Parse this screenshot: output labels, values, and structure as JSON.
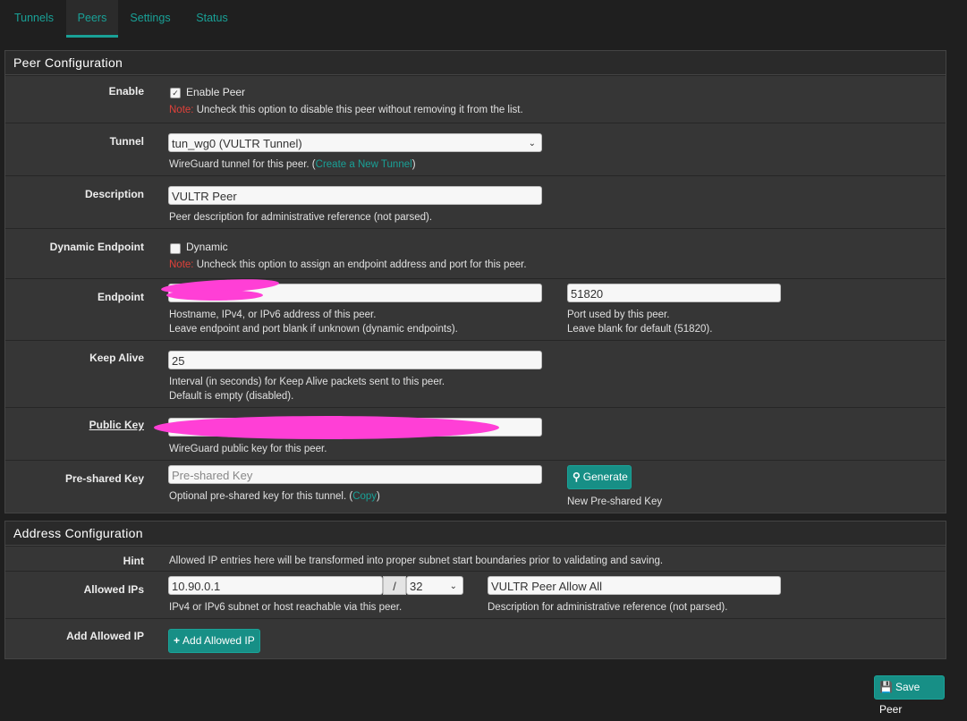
{
  "tabs": [
    {
      "label": "Tunnels"
    },
    {
      "label": "Peers",
      "active": true
    },
    {
      "label": "Settings"
    },
    {
      "label": "Status"
    }
  ],
  "peer_config": {
    "title": "Peer Configuration",
    "enable": {
      "label": "Enable",
      "checkbox_label": "Enable Peer",
      "checked": true,
      "note_prefix": "Note:",
      "note_text": " Uncheck this option to disable this peer without removing it from the list."
    },
    "tunnel": {
      "label": "Tunnel",
      "value": "tun_wg0 (VULTR Tunnel)",
      "help_pre": "WireGuard tunnel for this peer. (",
      "help_link": "Create a New Tunnel",
      "help_post": ")"
    },
    "description": {
      "label": "Description",
      "value": "VULTR Peer",
      "help": "Peer description for administrative reference (not parsed)."
    },
    "dynamic": {
      "label": "Dynamic Endpoint",
      "checkbox_label": "Dynamic",
      "checked": false,
      "note_prefix": "Note:",
      "note_text": " Uncheck this option to assign an endpoint address and port for this peer."
    },
    "endpoint": {
      "label": "Endpoint",
      "value": "",
      "help1": "Hostname, IPv4, or IPv6 address of this peer.",
      "help2": "Leave endpoint and port blank if unknown (dynamic endpoints).",
      "port": "51820",
      "port_help1": "Port used by this peer.",
      "port_help2": "Leave blank for default (51820)."
    },
    "keepalive": {
      "label": "Keep Alive",
      "value": "25",
      "help1": "Interval (in seconds) for Keep Alive packets sent to this peer.",
      "help2": "Default is empty (disabled)."
    },
    "public_key": {
      "label": "Public Key",
      "value": "",
      "help": "WireGuard public key for this peer."
    },
    "psk": {
      "label": "Pre-shared Key",
      "placeholder": "Pre-shared Key",
      "help_pre": "Optional pre-shared key for this tunnel. (",
      "help_link": "Copy",
      "help_post": ")",
      "generate_label": "Generate",
      "generate_help": "New Pre-shared Key"
    }
  },
  "address_config": {
    "title": "Address Configuration",
    "hint": {
      "label": "Hint",
      "text": "Allowed IP entries here will be transformed into proper subnet start boundaries prior to validating and saving."
    },
    "allowed": {
      "label": "Allowed IPs",
      "ip": "10.90.0.1",
      "slash": "/",
      "mask": "32",
      "ip_help": "IPv4 or IPv6 subnet or host reachable via this peer.",
      "desc": "VULTR Peer Allow All",
      "desc_help": "Description for administrative reference (not parsed)."
    },
    "add": {
      "label": "Add Allowed IP",
      "button": "Add Allowed IP"
    }
  },
  "save_button": "Save Peer",
  "colors": {
    "accent": "#19a197",
    "note": "#e0413a",
    "redaction": "#ff3fd6"
  }
}
